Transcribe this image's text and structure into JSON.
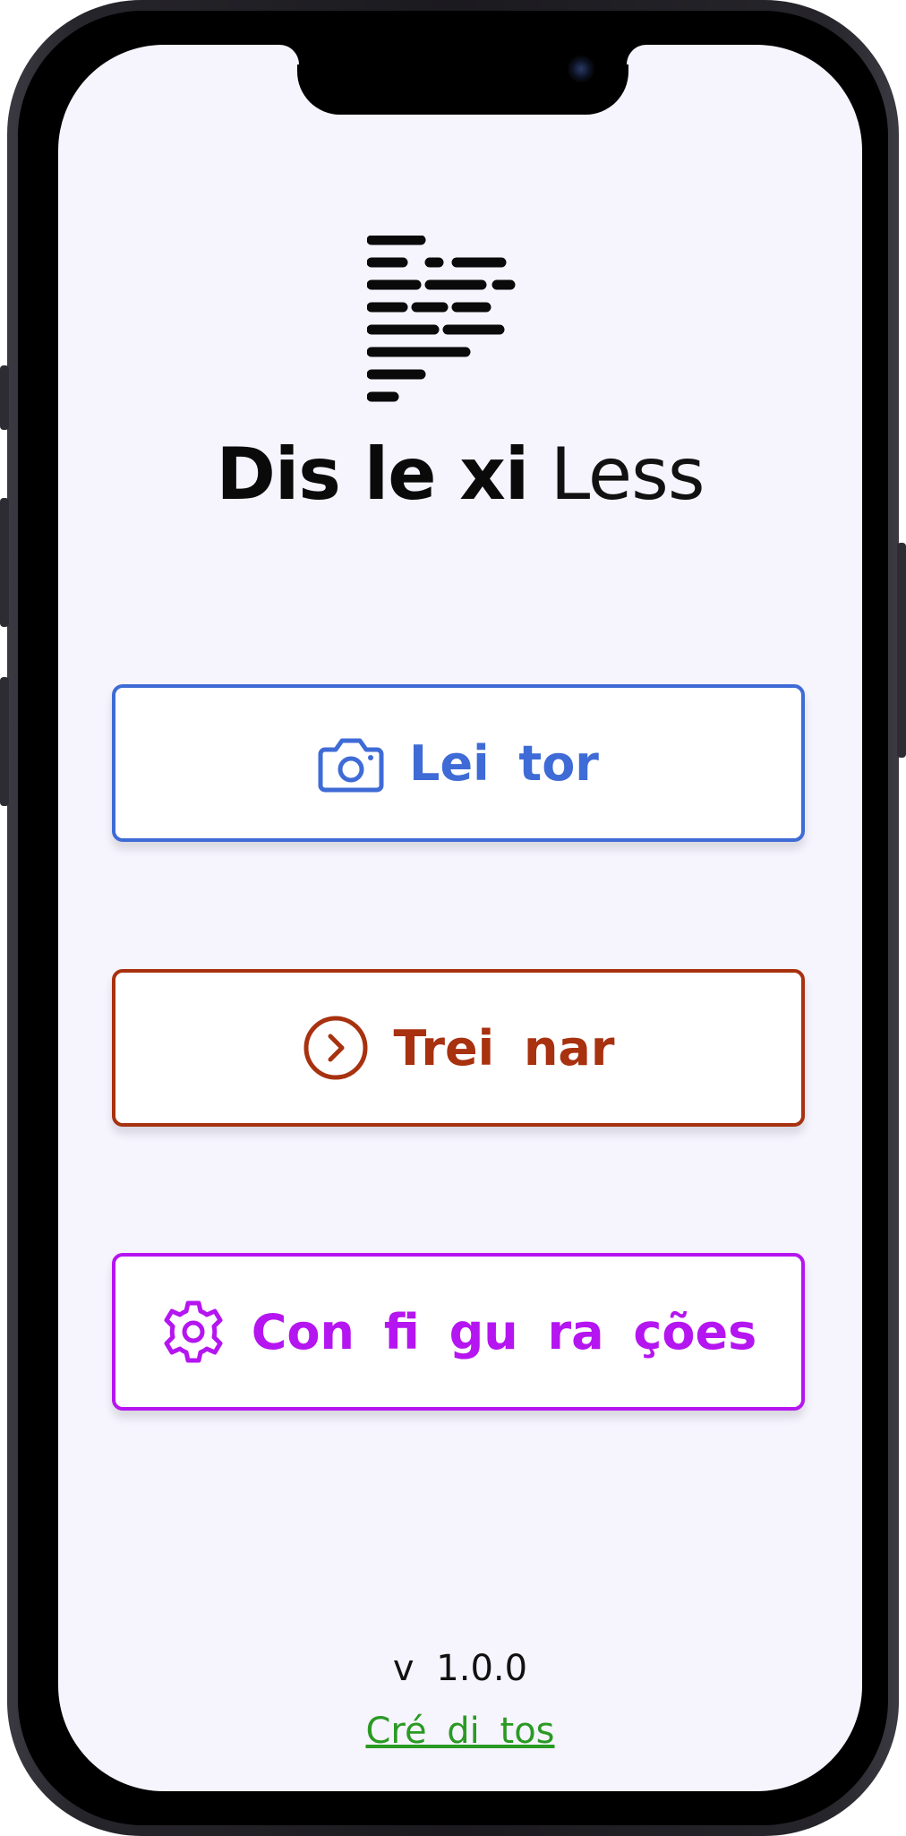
{
  "app": {
    "title_bold": "Dis le xi",
    "title_light": "Less"
  },
  "menu": {
    "reader": {
      "label": "Lei tor",
      "icon": "camera-icon",
      "color": "#3f6bd6"
    },
    "train": {
      "label": "Trei nar",
      "icon": "chevron-right-circle-icon",
      "color": "#a8310f"
    },
    "settings": {
      "label": "Con fi gu ra ções",
      "icon": "gear-icon",
      "color": "#b515f0"
    }
  },
  "footer": {
    "version": "v 1.0.0",
    "credits": "Cré di tos",
    "credits_color": "#2a9a23"
  },
  "colors": {
    "background": "#f6f4fd",
    "logo": "#0a0a0a"
  }
}
